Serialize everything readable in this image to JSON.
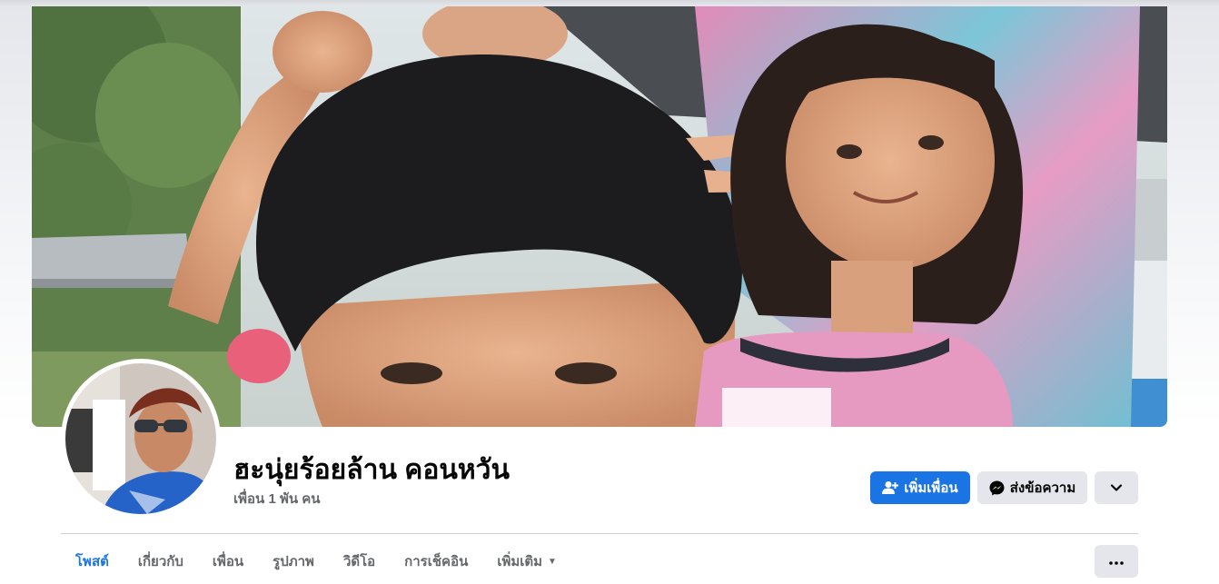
{
  "profile": {
    "name": "ฮะนุ่ยร้อยล้าน คอนหวัน",
    "friends_count": "เพื่อน 1 พัน คน"
  },
  "actions": {
    "add_friend_label": "เพิ่มเพื่อน",
    "message_label": "ส่งข้อความ"
  },
  "tabs": [
    {
      "label": "โพสต์",
      "active": true
    },
    {
      "label": "เกี่ยวกับ",
      "active": false
    },
    {
      "label": "เพื่อน",
      "active": false
    },
    {
      "label": "รูปภาพ",
      "active": false
    },
    {
      "label": "วิดีโอ",
      "active": false
    },
    {
      "label": "การเช็คอิน",
      "active": false
    },
    {
      "label": "เพิ่มเติม",
      "active": false
    }
  ],
  "icons": {
    "add_friend": "add-friend-icon",
    "messenger": "messenger-icon",
    "chevron": "chevron-down-icon",
    "more_tabs": "caret-down-icon",
    "ellipsis": "ellipsis-icon"
  },
  "colors": {
    "accent": "#1b74e4",
    "button_gray": "#e4e6eb",
    "text_primary": "#050505",
    "text_secondary": "#65676b"
  }
}
